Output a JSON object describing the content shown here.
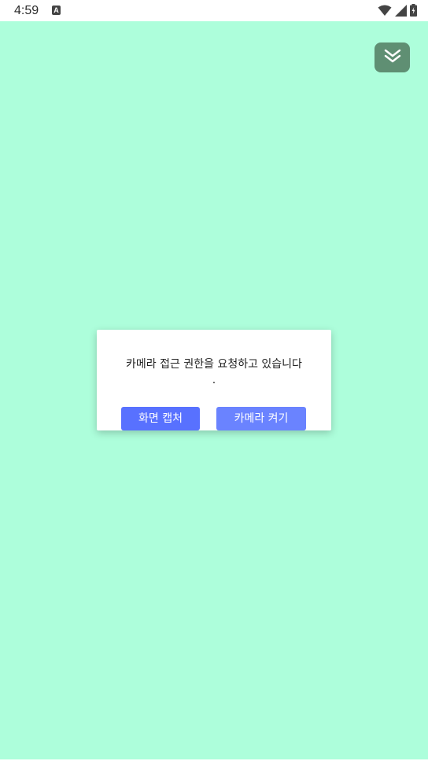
{
  "status_bar": {
    "time": "4:59",
    "notification_icon_letter": "A",
    "icons": [
      "wifi-icon",
      "signal-icon",
      "battery-icon"
    ]
  },
  "collapse_button": {
    "icon": "double-chevron-down-icon"
  },
  "dialog": {
    "message": "카메라 접근 권한을 요청하고 있습니다",
    "message_end": ".",
    "capture_button_label": "화면 캡처",
    "camera_button_label": "카메라 켜기"
  },
  "colors": {
    "background": "#adfedb",
    "collapse_button": "#5f8f73",
    "capture_button": "#5871ff",
    "camera_button": "#6a83ff"
  }
}
